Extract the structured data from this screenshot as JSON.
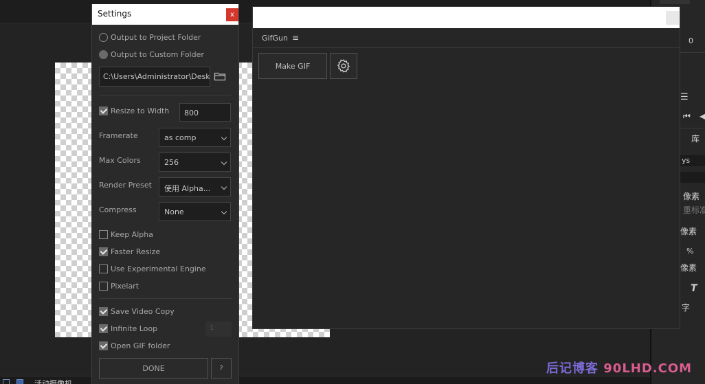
{
  "ae": {
    "right_panel": {
      "labels": [
        "0",
        "库",
        "ys",
        "像素",
        "重标准",
        "像素",
        "%",
        "像素",
        "T",
        "字"
      ]
    },
    "bottom_bar": {
      "camera_label": "活动摄像机"
    }
  },
  "gifgun": {
    "panel_title": "GifGun",
    "make_gif_label": "Make GIF"
  },
  "settings": {
    "title": "Settings",
    "close_label": "x",
    "output_project_label": "Output to Project Folder",
    "output_custom_label": "Output to Custom Folder",
    "output_mode": "custom",
    "custom_path": "C:\\Users\\Administrator\\Deskto",
    "resize_label": "Resize to Width",
    "resize_checked": true,
    "resize_width": "800",
    "framerate_label": "Framerate",
    "framerate_value": "as comp",
    "max_colors_label": "Max Colors",
    "max_colors_value": "256",
    "render_preset_label": "Render Preset",
    "render_preset_value": "使用 Alpha...",
    "compress_label": "Compress",
    "compress_value": "None",
    "keep_alpha_label": "Keep Alpha",
    "faster_resize_label": "Faster Resize",
    "experimental_label": "Use Experimental Engine",
    "pixelart_label": "Pixelart",
    "save_video_label": "Save Video Copy",
    "infinite_loop_label": "Infinite Loop",
    "loop_count": "1",
    "open_folder_label": "Open GIF folder",
    "done_label": "DONE",
    "help_label": "?"
  },
  "watermark": {
    "part_a": "后记博客",
    "part_b": "90LHD.COM"
  },
  "colors": {
    "close_red": "#d4372c",
    "panel_bg": "#2a2a2a",
    "check_fill": "#6a6a6a"
  }
}
